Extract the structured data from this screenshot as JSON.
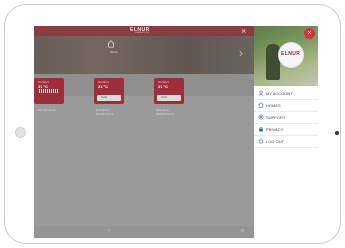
{
  "app": {
    "brand": "ELNUR",
    "brand_sub": "GABARRON",
    "close_symbol": "×"
  },
  "hero": {
    "home_label": "home",
    "section_label": "Home"
  },
  "devices": [
    {
      "mode": "Comfort",
      "temp": "21 °C",
      "bar_label": "Modo",
      "name": "ELNUR 20 1F"
    },
    {
      "mode": "Comfort",
      "temp": "21 °C",
      "bar_label": "Modo",
      "name": "Dormitorio\nELNUR 20 1F"
    },
    {
      "mode": "Comfort",
      "temp": "21 °C",
      "bar_label": "Modo",
      "name": "Dormitorio\nELNUR 20 1F"
    }
  ],
  "side_menu": {
    "logo_text": "ELNUR",
    "close_symbol": "×",
    "items": [
      {
        "label": "MY ACCOUNT",
        "icon": "user-icon"
      },
      {
        "label": "HOMES",
        "icon": "house-icon"
      },
      {
        "label": "SUPPORT",
        "icon": "support-icon"
      },
      {
        "label": "PRIVACY",
        "icon": "lock-icon"
      },
      {
        "label": "LOG OUT",
        "icon": "power-icon"
      }
    ]
  },
  "colors": {
    "brand_red": "#8d3b43",
    "tile_red": "#9c2f3a",
    "close_red": "#d0343f"
  }
}
